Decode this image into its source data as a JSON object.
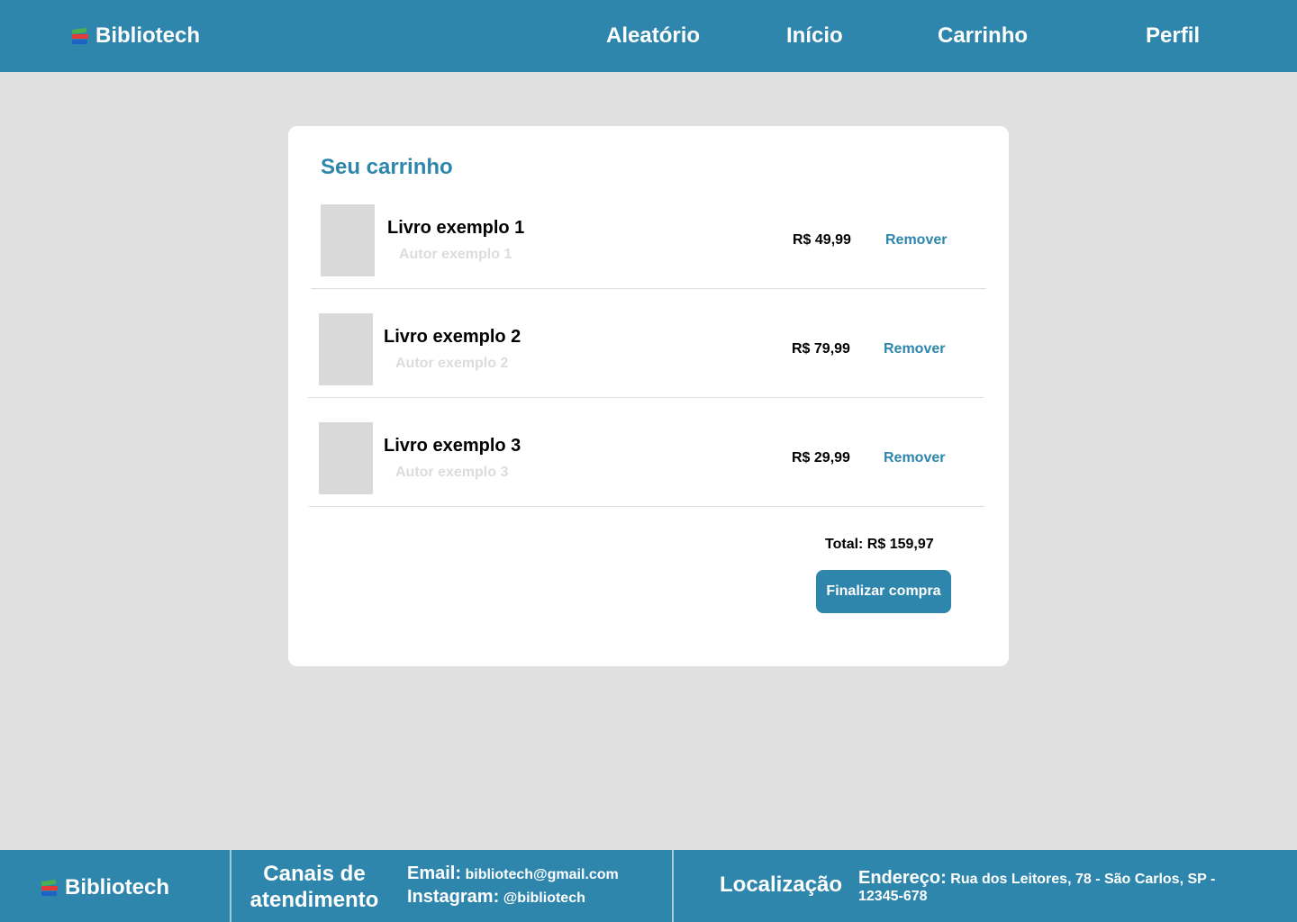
{
  "header": {
    "brand": "Bibliotech",
    "nav": {
      "aleatorio": "Aleatório",
      "inicio": "Início",
      "carrinho": "Carrinho",
      "perfil": "Perfil"
    }
  },
  "cart": {
    "title": "Seu carrinho",
    "items": [
      {
        "title": "Livro exemplo 1",
        "author": "Autor exemplo 1",
        "price": "R$ 49,99",
        "remove_label": "Remover"
      },
      {
        "title": "Livro exemplo 2",
        "author": "Autor exemplo 2",
        "price": "R$ 79,99",
        "remove_label": "Remover"
      },
      {
        "title": "Livro exemplo 3",
        "author": "Autor exemplo 3",
        "price": "R$ 29,99",
        "remove_label": "Remover"
      }
    ],
    "total": "Total: R$ 159,97",
    "checkout_label": "Finalizar compra"
  },
  "footer": {
    "brand": "Bibliotech",
    "contact_heading": "Canais de atendimento",
    "email_label": "Email:",
    "email_value": "bibliotech@gmail.com",
    "instagram_label": "Instagram:",
    "instagram_value": "@bibliotech",
    "location_heading": "Localização",
    "address_label": "Endereço:",
    "address_value": "Rua dos Leitores, 78 - São Carlos, SP - 12345-678"
  },
  "colors": {
    "primary": "#2e86ad",
    "background": "#e0e0e0",
    "card": "#ffffff",
    "placeholder": "#d9d9d9"
  },
  "icons": {
    "brand": "books-icon"
  }
}
